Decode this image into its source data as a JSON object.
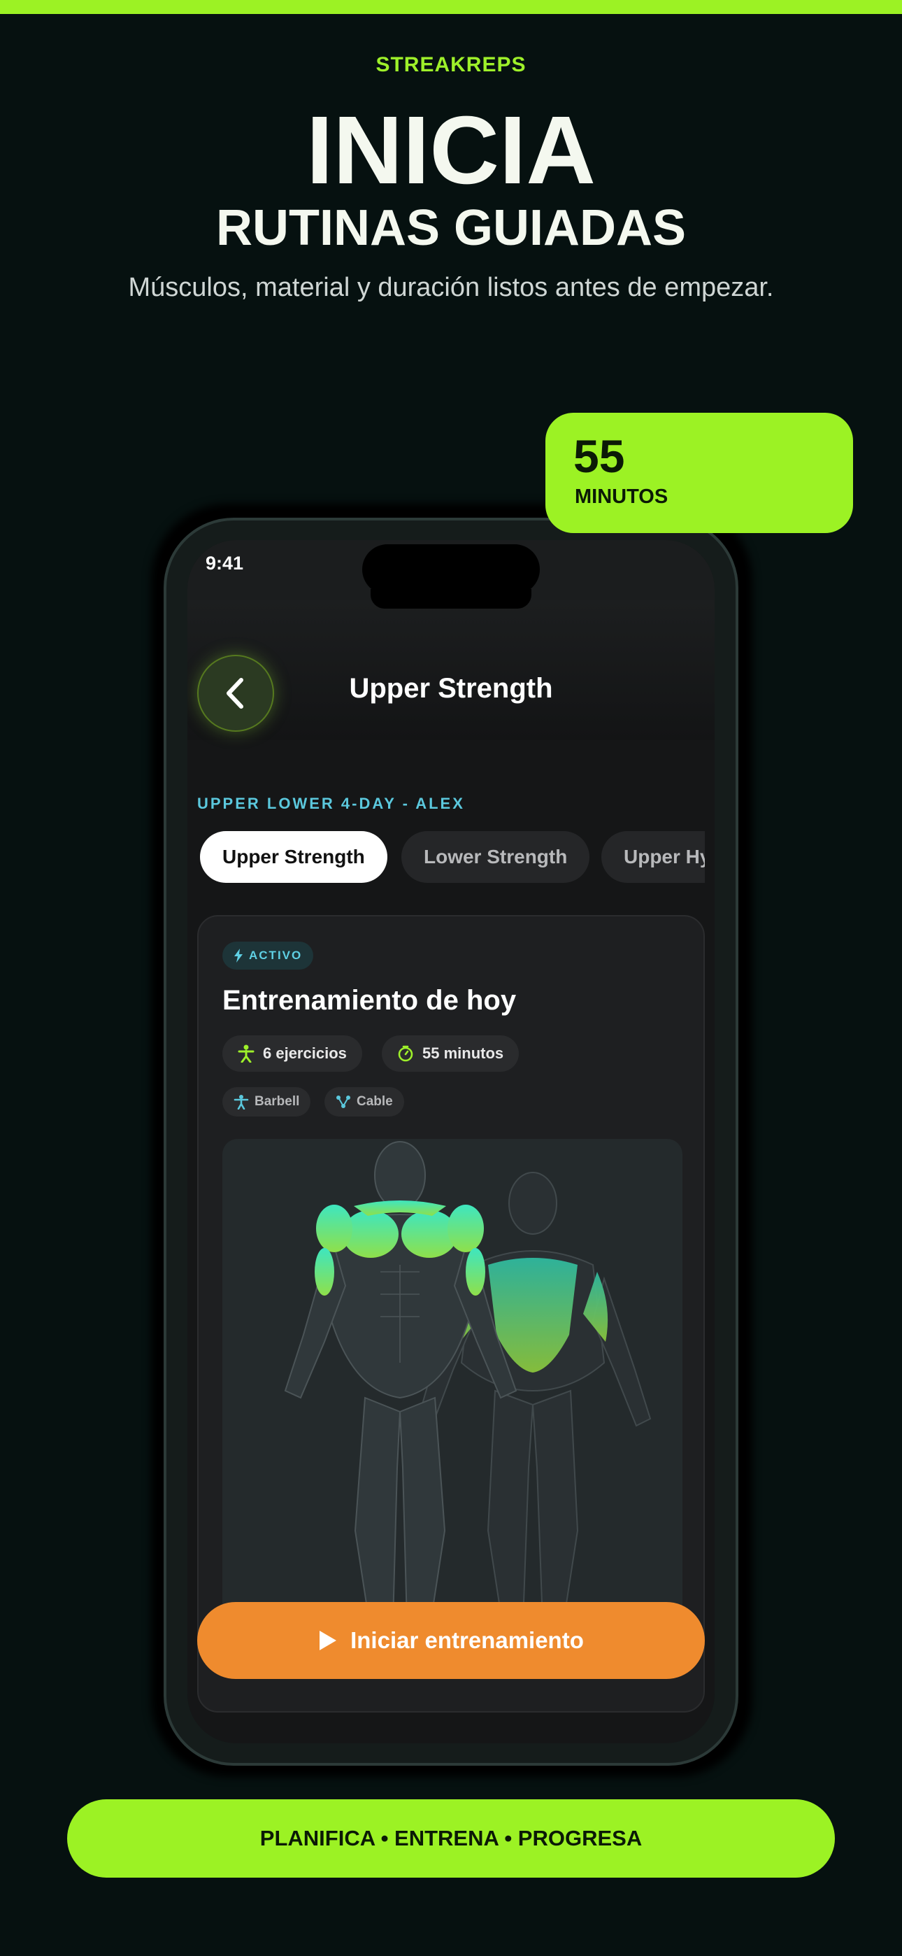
{
  "brand": "STREAKREPS",
  "headline": "INICIA",
  "subheadline": "RUTINAS GUIADAS",
  "tagline": "Músculos, material y duración listos antes de empezar.",
  "badge_card": {
    "value": "55",
    "label": "MINUTOS"
  },
  "phone": {
    "status_time": "9:41",
    "nav_title": "Upper Strength",
    "plan_label": "UPPER LOWER 4-DAY - ALEX",
    "tabs": [
      {
        "label": "Upper Strength",
        "active": true
      },
      {
        "label": "Lower Strength",
        "active": false
      },
      {
        "label": "Upper Hy",
        "active": false
      }
    ],
    "workout_card": {
      "status_badge": "ACTIVO",
      "title": "Entrenamiento de hoy",
      "exercises": "6 ejercicios",
      "duration": "55 minutos",
      "equipment": [
        "Barbell",
        "Cable"
      ]
    },
    "start_button": "Iniciar entrenamiento"
  },
  "footer": "PLANIFICA • ENTRENA • PROGRESA",
  "colors": {
    "accent": "#9cf224",
    "cta": "#ef8b2e",
    "teal": "#5bc8dd",
    "background": "#061110"
  }
}
